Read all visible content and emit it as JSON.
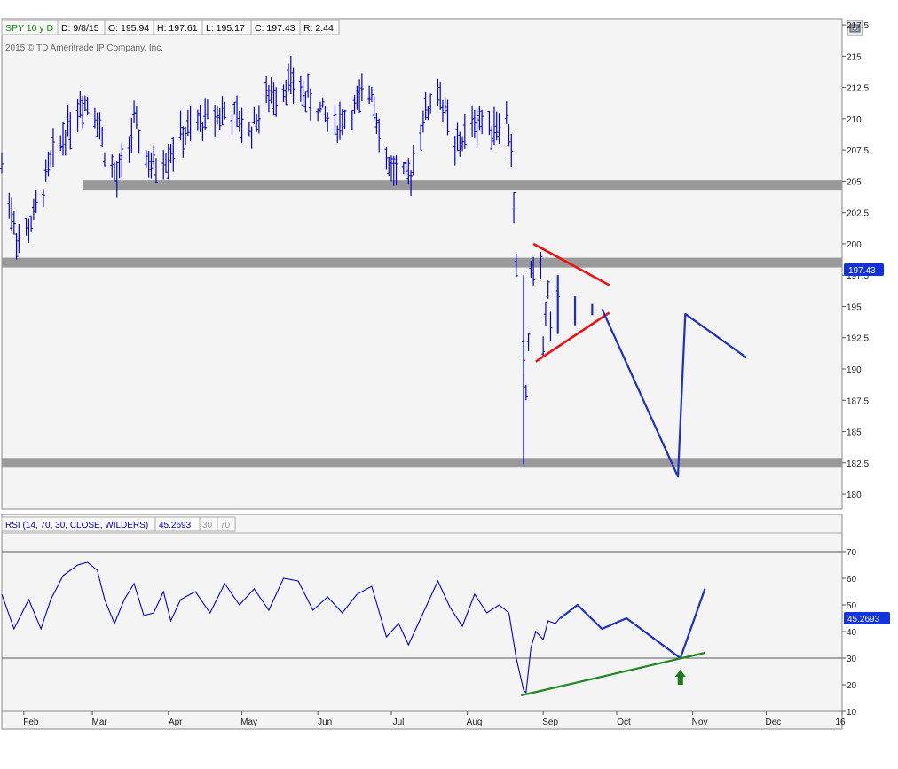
{
  "header": {
    "symbol": "SPY 10 y D",
    "date": "D: 9/8/15",
    "open": "O: 195.94",
    "high": "H: 197.61",
    "low": "L: 195.17",
    "close": "C: 197.43",
    "range": "R: 2.44",
    "copyright": "2015 © TD Ameritrade IP Company, Inc."
  },
  "rsi_header": {
    "label": "RSI (14, 70, 30, CLOSE, WILDERS)",
    "value": "45.2693",
    "oversold": "30",
    "overbought": "70"
  },
  "price_tag": "197.43",
  "rsi_tag": "45.2693",
  "colors": {
    "background": "#f4f4f4",
    "bars": "#0000dd",
    "zones": "#999999",
    "triangle": "#ee1111",
    "projection": "#1a2fcc",
    "support_line": "#1e8a1e",
    "arrow": "#1a7a1a"
  },
  "chart_data": [
    {
      "type": "ohlc",
      "title": "SPY 10 y D",
      "x_axis": {
        "labels": [
          "Feb",
          "Mar",
          "Apr",
          "May",
          "Jun",
          "Jul",
          "Aug",
          "Sep",
          "Oct",
          "Nov",
          "Dec",
          "16"
        ],
        "range": [
          "2015-01-23",
          "2016-01-01"
        ]
      },
      "y_axis": {
        "ticks": [
          "217.5",
          "215",
          "212.5",
          "210",
          "207.5",
          "205",
          "202.5",
          "200",
          "197.5",
          "195",
          "192.5",
          "190",
          "187.5",
          "185",
          "182.5",
          "180"
        ],
        "range": [
          178.8,
          218.0
        ]
      },
      "last_close": 197.43,
      "support_resistance_zones": [
        204.7,
        198.5,
        182.5
      ],
      "triangle": {
        "upper": [
          {
            "x": "2015-08-28",
            "y": 200.0
          },
          {
            "x": "2015-09-28",
            "y": 196.7
          }
        ],
        "lower": [
          {
            "x": "2015-08-29",
            "y": 190.6
          },
          {
            "x": "2015-09-28",
            "y": 194.5
          }
        ]
      },
      "projected_bars": [
        {
          "x": "2015-09-07",
          "high": 197.5,
          "low": 192.8
        },
        {
          "x": "2015-09-14",
          "high": 195.8,
          "low": 193.5
        },
        {
          "x": "2015-09-21",
          "high": 195.2,
          "low": 194.3
        }
      ],
      "projection_path": [
        {
          "x": "2015-09-25",
          "y": 194.8
        },
        {
          "x": "2015-10-26",
          "y": 181.4
        },
        {
          "x": "2015-10-29",
          "y": 194.4
        },
        {
          "x": "2015-11-23",
          "y": 190.9
        }
      ],
      "price_path": [
        {
          "x": "2015-01-23",
          "y": 206.2
        },
        {
          "x": "2015-01-30",
          "y": 200.0
        },
        {
          "x": "2015-02-05",
          "y": 202.0
        },
        {
          "x": "2015-02-12",
          "y": 206.5
        },
        {
          "x": "2015-02-18",
          "y": 209.0
        },
        {
          "x": "2015-02-25",
          "y": 211.5
        },
        {
          "x": "2015-03-02",
          "y": 211.0
        },
        {
          "x": "2015-03-06",
          "y": 207.5
        },
        {
          "x": "2015-03-11",
          "y": 205.0
        },
        {
          "x": "2015-03-18",
          "y": 209.5
        },
        {
          "x": "2015-03-25",
          "y": 206.0
        },
        {
          "x": "2015-03-31",
          "y": 207.0
        },
        {
          "x": "2015-04-06",
          "y": 208.5
        },
        {
          "x": "2015-04-13",
          "y": 209.5
        },
        {
          "x": "2015-04-20",
          "y": 210.5
        },
        {
          "x": "2015-04-27",
          "y": 210.3
        },
        {
          "x": "2015-05-04",
          "y": 209.0
        },
        {
          "x": "2015-05-11",
          "y": 211.5
        },
        {
          "x": "2015-05-20",
          "y": 213.0
        },
        {
          "x": "2015-05-29",
          "y": 211.5
        },
        {
          "x": "2015-06-08",
          "y": 209.5
        },
        {
          "x": "2015-06-17",
          "y": 211.0
        },
        {
          "x": "2015-06-23",
          "y": 212.5
        },
        {
          "x": "2015-06-29",
          "y": 206.5
        },
        {
          "x": "2015-07-08",
          "y": 205.0
        },
        {
          "x": "2015-07-13",
          "y": 209.5
        },
        {
          "x": "2015-07-20",
          "y": 212.5
        },
        {
          "x": "2015-07-27",
          "y": 207.5
        },
        {
          "x": "2015-08-05",
          "y": 210.0
        },
        {
          "x": "2015-08-10",
          "y": 209.5
        },
        {
          "x": "2015-08-17",
          "y": 210.0
        },
        {
          "x": "2015-08-19",
          "y": 207.5
        },
        {
          "x": "2015-08-20",
          "y": 203.0
        },
        {
          "x": "2015-08-21",
          "y": 198.0
        },
        {
          "x": "2015-08-24",
          "y": 190.5
        },
        {
          "x": "2015-08-25",
          "y": 188.0
        },
        {
          "x": "2015-08-26",
          "y": 192.5
        },
        {
          "x": "2015-08-27",
          "y": 197.5
        },
        {
          "x": "2015-08-28",
          "y": 198.5
        },
        {
          "x": "2015-08-31",
          "y": 197.5
        },
        {
          "x": "2015-09-01",
          "y": 192.0
        },
        {
          "x": "2015-09-02",
          "y": 194.5
        },
        {
          "x": "2015-09-03",
          "y": 195.5
        },
        {
          "x": "2015-09-04",
          "y": 192.5
        },
        {
          "x": "2015-09-08",
          "y": 197.4
        }
      ],
      "selloff_bar": {
        "x": "2015-08-24",
        "high": 197.5,
        "low": 182.4
      }
    },
    {
      "type": "line",
      "title": "RSI (14, 70, 30, CLOSE, WILDERS)",
      "y_axis": {
        "ticks": [
          "70",
          "60",
          "50",
          "40",
          "30",
          "20",
          "10"
        ],
        "range": [
          10,
          77
        ]
      },
      "levels": [
        70,
        30
      ],
      "last_value": 45.2693,
      "series": [
        {
          "values": [
            {
              "x": "2015-01-23",
              "y": 54
            },
            {
              "x": "2015-01-28",
              "y": 41
            },
            {
              "x": "2015-02-03",
              "y": 52
            },
            {
              "x": "2015-02-08",
              "y": 41
            },
            {
              "x": "2015-02-12",
              "y": 52
            },
            {
              "x": "2015-02-17",
              "y": 61
            },
            {
              "x": "2015-02-23",
              "y": 65
            },
            {
              "x": "2015-02-27",
              "y": 66
            },
            {
              "x": "2015-03-03",
              "y": 63
            },
            {
              "x": "2015-03-06",
              "y": 52
            },
            {
              "x": "2015-03-10",
              "y": 43
            },
            {
              "x": "2015-03-14",
              "y": 52
            },
            {
              "x": "2015-03-18",
              "y": 58
            },
            {
              "x": "2015-03-22",
              "y": 46
            },
            {
              "x": "2015-03-26",
              "y": 47
            },
            {
              "x": "2015-03-30",
              "y": 55
            },
            {
              "x": "2015-04-02",
              "y": 44
            },
            {
              "x": "2015-04-06",
              "y": 52
            },
            {
              "x": "2015-04-12",
              "y": 55
            },
            {
              "x": "2015-04-18",
              "y": 47
            },
            {
              "x": "2015-04-24",
              "y": 58
            },
            {
              "x": "2015-04-30",
              "y": 50
            },
            {
              "x": "2015-05-06",
              "y": 56
            },
            {
              "x": "2015-05-12",
              "y": 48
            },
            {
              "x": "2015-05-18",
              "y": 60
            },
            {
              "x": "2015-05-24",
              "y": 59
            },
            {
              "x": "2015-05-30",
              "y": 48
            },
            {
              "x": "2015-06-05",
              "y": 53
            },
            {
              "x": "2015-06-11",
              "y": 47
            },
            {
              "x": "2015-06-17",
              "y": 54
            },
            {
              "x": "2015-06-23",
              "y": 57
            },
            {
              "x": "2015-06-29",
              "y": 38
            },
            {
              "x": "2015-07-04",
              "y": 43
            },
            {
              "x": "2015-07-08",
              "y": 35
            },
            {
              "x": "2015-07-14",
              "y": 47
            },
            {
              "x": "2015-07-20",
              "y": 59
            },
            {
              "x": "2015-07-25",
              "y": 49
            },
            {
              "x": "2015-07-30",
              "y": 42
            },
            {
              "x": "2015-08-04",
              "y": 54
            },
            {
              "x": "2015-08-09",
              "y": 47
            },
            {
              "x": "2015-08-14",
              "y": 50
            },
            {
              "x": "2015-08-18",
              "y": 47
            },
            {
              "x": "2015-08-21",
              "y": 30
            },
            {
              "x": "2015-08-24",
              "y": 18
            },
            {
              "x": "2015-08-25",
              "y": 17
            },
            {
              "x": "2015-08-27",
              "y": 34
            },
            {
              "x": "2015-08-29",
              "y": 40
            },
            {
              "x": "2015-09-01",
              "y": 37
            },
            {
              "x": "2015-09-03",
              "y": 44
            },
            {
              "x": "2015-09-06",
              "y": 43
            },
            {
              "x": "2015-09-08",
              "y": 45.27
            }
          ]
        }
      ],
      "projection_path": [
        {
          "x": "2015-09-08",
          "y": 45
        },
        {
          "x": "2015-09-15",
          "y": 50
        },
        {
          "x": "2015-09-25",
          "y": 41
        },
        {
          "x": "2015-10-05",
          "y": 45
        },
        {
          "x": "2015-10-27",
          "y": 30
        },
        {
          "x": "2015-11-06",
          "y": 56
        }
      ],
      "trend_line": [
        {
          "x": "2015-08-23",
          "y": 16
        },
        {
          "x": "2015-11-06",
          "y": 32
        }
      ],
      "arrow_marker": {
        "x": "2015-10-27",
        "y": 20
      }
    }
  ]
}
